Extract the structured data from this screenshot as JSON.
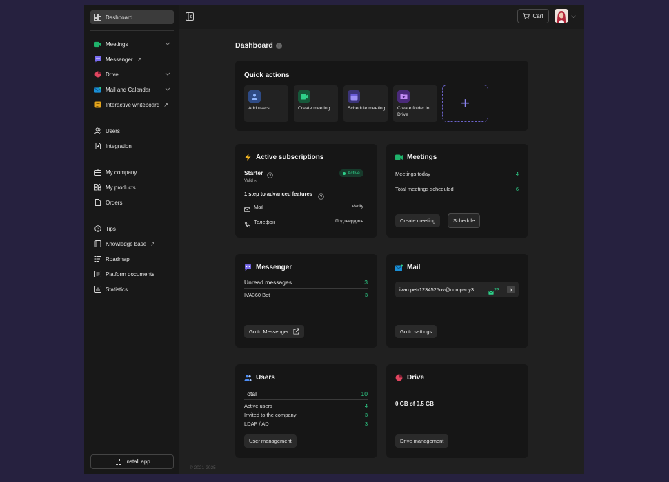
{
  "sidebar": {
    "dashboard": "Dashboard",
    "meetings": "Meetings",
    "messenger": "Messenger",
    "drive": "Drive",
    "mail_calendar": "Mail and Calendar",
    "whiteboard": "Interactive whiteboard",
    "users": "Users",
    "integration": "Integration",
    "my_company": "My company",
    "my_products": "My products",
    "orders": "Orders",
    "tips": "Tips",
    "knowledge_base": "Knowledge base",
    "roadmap": "Roadmap",
    "platform_documents": "Platform documents",
    "statistics": "Statistics",
    "install_app": "Install app",
    "ext_arrow": "↗"
  },
  "topbar": {
    "cart": "Cart"
  },
  "page": {
    "title": "Dashboard",
    "info": "i",
    "copyright": "© 2021-2025"
  },
  "quick_actions": {
    "title": "Quick actions",
    "items": [
      "Add users",
      "Create meeting",
      "Schedule meeting",
      "Create folder in Drive"
    ],
    "add": "+"
  },
  "subscriptions": {
    "title": "Active subscriptions",
    "plan": "Starter",
    "help": "?",
    "status": "Active",
    "valid": "Valid ∞",
    "step": "1 step to advanced features",
    "mail_label": "Mail",
    "mail_action": "Verify",
    "phone_label": "Телефон",
    "phone_action": "Подтвердить"
  },
  "meetings": {
    "title": "Meetings",
    "today_label": "Meetings today",
    "today_value": "4",
    "total_label": "Total meetings scheduled",
    "total_value": "6",
    "create_btn": "Create meeting",
    "schedule_btn": "Schedule"
  },
  "messenger": {
    "title": "Messenger",
    "unread_label": "Unread messages",
    "unread_value": "3",
    "bot_label": "IVA360 Bot",
    "bot_value": "3",
    "go_btn": "Go to Messenger"
  },
  "mail": {
    "title": "Mail",
    "address": "ivan.petr1234525ov@company3...",
    "count": "23",
    "settings_btn": "Go to settings"
  },
  "users": {
    "title": "Users",
    "total_label": "Total",
    "total_value": "10",
    "active_label": "Active users",
    "active_value": "4",
    "invited_label": "Invited to the company",
    "invited_value": "3",
    "ldap_label": "LDAP / AD",
    "ldap_value": "3",
    "manage_btn": "User management"
  },
  "drive": {
    "title": "Drive",
    "usage": "0 GB of 0.5 GB",
    "manage_btn": "Drive management"
  },
  "colors": {
    "accent_green": "#2fd08a",
    "meetings_icon": "#1fb26b",
    "messenger_icon": "#7a6cf0",
    "drive_icon": "#e0455f",
    "mail_icon": "#1a8fd6",
    "whiteboard_icon": "#e3a41c",
    "users_icon": "#4d8ef7"
  }
}
